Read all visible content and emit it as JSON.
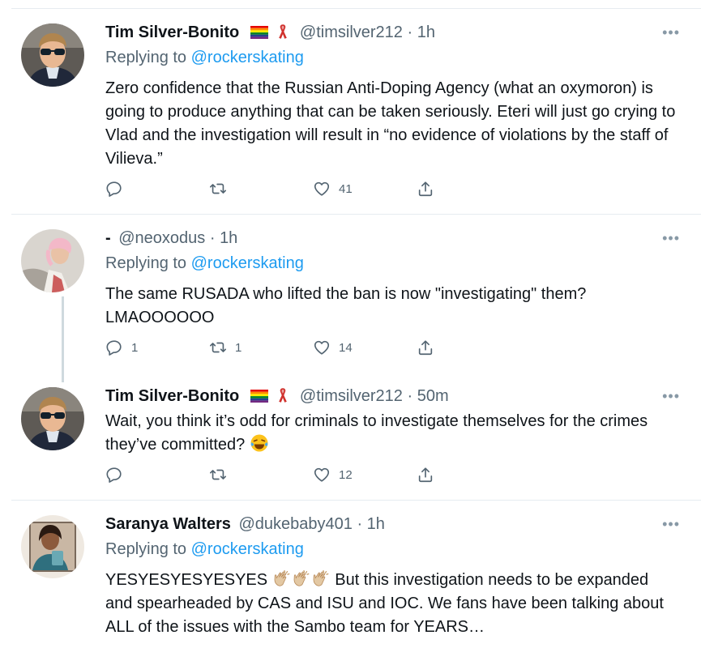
{
  "tweets": [
    {
      "name": "Tim Silver-Bonito",
      "handle": "@timsilver212",
      "time": "1h",
      "replying_prefix": "Replying to",
      "replying_to": "@rockerskating",
      "text": "Zero confidence that the Russian Anti-Doping Agency (what an oxymoron) is going to produce anything that can be taken seriously. Eteri will just go crying to Vlad and the investigation will result in “no evidence of violations by the staff of Vilieva.”",
      "replies": "",
      "retweets": "",
      "likes": "41"
    },
    {
      "name": "-",
      "handle": "@neoxodus",
      "time": "1h",
      "replying_prefix": "Replying to",
      "replying_to": "@rockerskating",
      "text": "The same RUSADA who lifted the ban is now \"investigating\" them? LMAOOOOOO",
      "replies": "1",
      "retweets": "1",
      "likes": "14"
    },
    {
      "name": "Tim Silver-Bonito",
      "handle": "@timsilver212",
      "time": "50m",
      "text": "Wait, you think it’s odd for criminals to investigate themselves for the crimes they’ve committed?",
      "emoji": "face-with-tears-of-joy",
      "replies": "",
      "retweets": "",
      "likes": "12"
    },
    {
      "name": "Saranya Walters",
      "handle": "@dukebaby401",
      "time": "1h",
      "replying_prefix": "Replying to",
      "replying_to": "@rockerskating",
      "text_a": "YESYESYESYESYES",
      "emoji": "clapping-hands",
      "text_b": "But this investigation needs to be expanded and spearheaded by CAS and ISU and IOC. We fans have been talking about ALL of the issues with the Sambo team for YEARS…"
    }
  ],
  "icons": {
    "reply": "reply-icon",
    "retweet": "retweet-icon",
    "like": "like-icon",
    "share": "share-icon",
    "more": "more-icon"
  },
  "colors": {
    "link": "#1d9bf0",
    "muted": "#536471",
    "divider": "#e6ecf0"
  }
}
